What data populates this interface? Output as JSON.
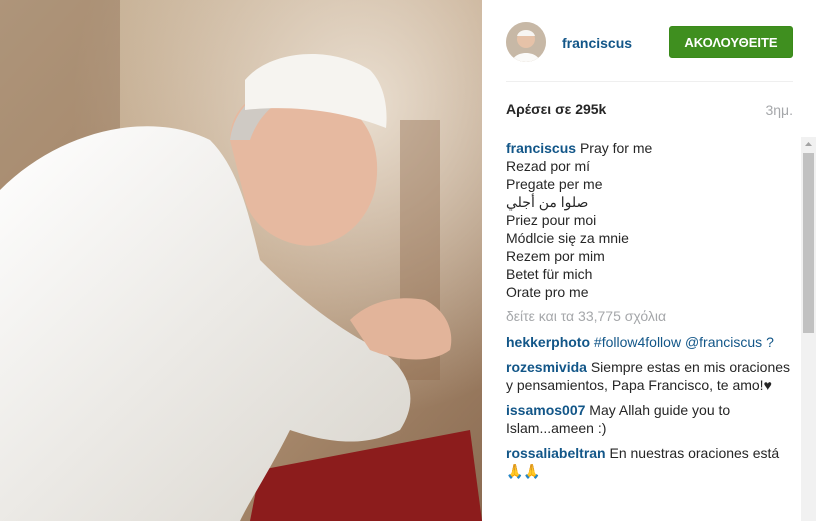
{
  "post": {
    "username": "francis­cus",
    "follow_label": "ΑΚΟΛΟΥΘΕΙΤΕ",
    "likes": "Αρέσει σε 295k",
    "time": "3ημ.",
    "caption": {
      "first": "Pray for me",
      "lines": [
        "Rezad por mí",
        "Pregate per me",
        "صلوا من أجلي",
        "Priez pour moi",
        "Módlcie się za mnie",
        "Rezem por mim",
        "Betet für mich",
        "Orate pro me"
      ]
    },
    "view_all": "δείτε και τα 33,775 σχόλια"
  },
  "comments": [
    {
      "user": "hekkerphoto",
      "text": "#follow4follow @franciscus ?"
    },
    {
      "user": "rozesmivida",
      "text": "Siempre estas en mis oraciones y pensamientos, Papa Francisco, te amo!♥"
    },
    {
      "user": "issamos007",
      "text": "May Allah guide you to Islam...ameen :)"
    },
    {
      "user": "rossaliabeltran",
      "text": "En nuestras oraciones está 🙏🙏"
    }
  ],
  "colors": {
    "link": "#125688",
    "follow": "#3f8f1f",
    "muted": "#a5a7aa"
  }
}
